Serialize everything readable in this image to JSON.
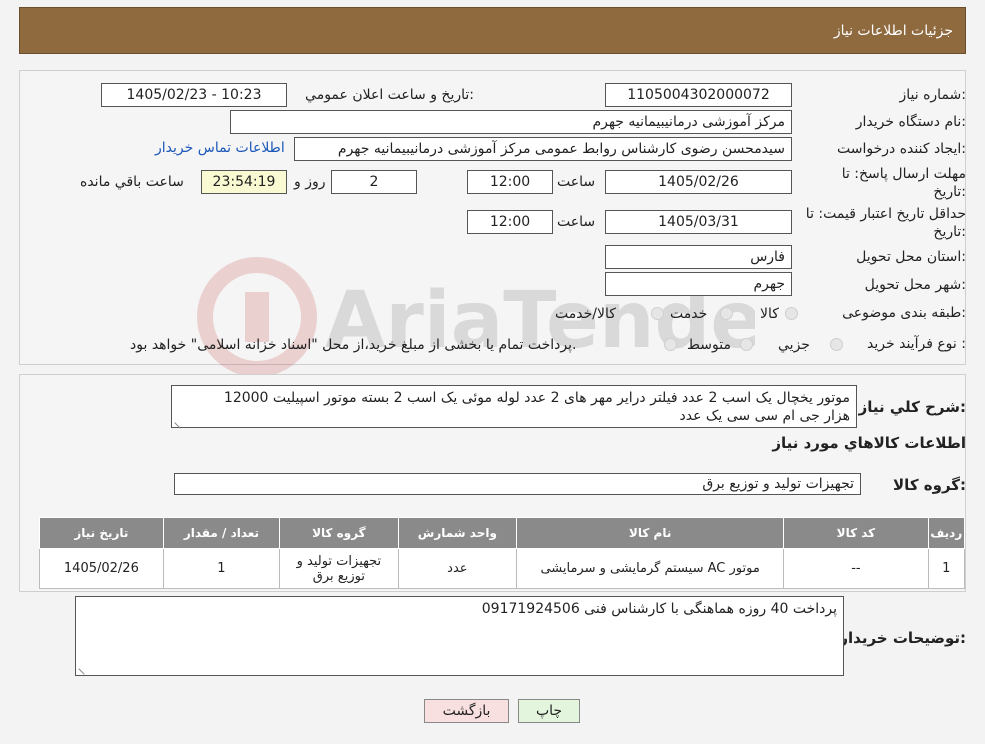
{
  "header": {
    "title": "جزئیات اطلاعات نیاز"
  },
  "form": {
    "need_number_label": "شماره نیاز:",
    "need_number": "1105004302000072",
    "announce_label": "تاریخ و ساعت اعلان عمومي:",
    "announce_value": "1405/02/23 - 10:23",
    "buyer_org_label": "نام دستگاه خريدار:",
    "buyer_org": "مرکز آموزشی درمانیبیمانیه جهرم",
    "creator_label": "ایجاد کننده درخواست:",
    "creator": "سیدمحسن رضوی کارشناس روابط عمومی مرکز آموزشی درمانیبیمانیه جهرم",
    "contact_link": "اطلاعات تماس خریدار",
    "deadline_label_1": "مهلت ارسال پاسخ: تا",
    "deadline_label_2": "تاریخ:",
    "deadline_date": "1405/02/26",
    "time_label": "ساعت",
    "deadline_time": "12:00",
    "days_value": "2",
    "days_label": "روز و",
    "remaining_time": "23:54:19",
    "remaining_label": "ساعت باقي مانده",
    "validity_label_1": "حداقل تاریخ اعتبار قیمت: تا",
    "validity_label_2": "تاریخ:",
    "validity_date": "1405/03/31",
    "validity_time": "12:00",
    "province_label": "استان محل تحویل:",
    "province": "فارس",
    "city_label": "شهر محل تحویل:",
    "city": "جهرم",
    "category_label": "طبقه بندی موضوعی:",
    "category_options": [
      "کالا",
      "خدمت",
      "کالا/خدمت"
    ],
    "process_label": "نوع فرآیند خرید :",
    "process_options": [
      "جزیي",
      "متوسط"
    ],
    "process_note": "پرداخت تمام یا بخشی از مبلغ خرید،از محل \"اسناد خزانه اسلامی\" خواهد بود."
  },
  "description": {
    "label": "شرح کلي نياز:",
    "text_line1": "موتور یخچال یک اسب 2 عدد فیلتر درایر مهر های 2 عدد لوله موئی یک اسب 2 بسته موتور اسپیلیت 12000",
    "text_line2": "هزار جی ام سی سی یک عدد"
  },
  "goods": {
    "section_title": "اطلاعات کالاهاي مورد نياز",
    "group_label": "گروه کالا:",
    "group_value": "تجهیزات تولید و توزیع برق",
    "table": {
      "headers": [
        "رديف",
        "کد کالا",
        "نام کالا",
        "واحد شمارش",
        "گروه کالا",
        "تعداد / مقدار",
        "تاریخ نیاز"
      ],
      "rows": [
        [
          "1",
          "--",
          "موتور AC سیستم گرمایشی و سرمایشی",
          "عدد",
          "تجهیزات تولید و توزیع برق",
          "1",
          "1405/02/26"
        ]
      ]
    }
  },
  "buyer_notes": {
    "label": "توضیحات خریدار:",
    "text": "پرداخت 40 روزه  هماهنگی با کارشناس فنی 09171924506"
  },
  "buttons": {
    "print": "چاپ",
    "back": "بازگشت"
  },
  "colors": {
    "header_bg": "#8e6a3e",
    "link": "#1a57b8",
    "print_btn": "#e4f5dd",
    "back_btn": "#f8e0e0"
  }
}
